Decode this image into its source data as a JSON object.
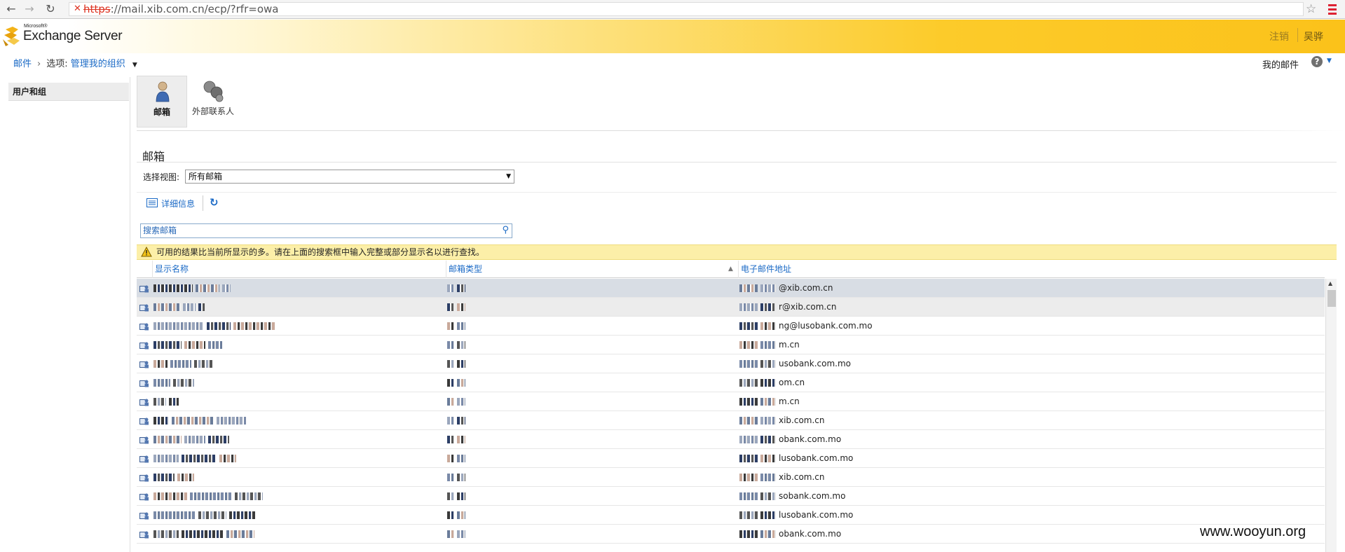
{
  "browser": {
    "url_scheme": "https",
    "url_rest": "://mail.xib.com.cn/ecp/?rfr=owa"
  },
  "header": {
    "logo_small": "Microsoft®",
    "logo_title": "Exchange Server",
    "signout": "注销",
    "user_name": "吴骅"
  },
  "breadcrumb": {
    "mail": "邮件",
    "options_prefix": "选项:",
    "options_link": "管理我的组织"
  },
  "top_right": {
    "my_mail": "我的邮件",
    "help": "?"
  },
  "sidebar": {
    "items": [
      {
        "label": "用户和组"
      }
    ]
  },
  "tabs": [
    {
      "label": "邮箱"
    },
    {
      "label": "外部联系人"
    }
  ],
  "section": {
    "title": "邮箱",
    "view_label": "选择视图:",
    "view_selected": "所有邮箱"
  },
  "toolbar": {
    "details": "详细信息"
  },
  "search": {
    "placeholder": "搜索邮箱"
  },
  "warning": {
    "text": "可用的结果比当前所显示的多。请在上面的搜索框中输入完整或部分显示名以进行查找。"
  },
  "grid": {
    "columns": [
      "显示名称",
      "邮箱类型",
      "电子邮件地址"
    ],
    "rows": [
      {
        "email_visible": "@xib.com.cn"
      },
      {
        "email_visible": "r@xib.com.cn"
      },
      {
        "email_visible": "ng@lusobank.com.mo"
      },
      {
        "email_visible": "m.cn"
      },
      {
        "email_visible": "usobank.com.mo"
      },
      {
        "email_visible": "om.cn"
      },
      {
        "email_visible": "m.cn"
      },
      {
        "email_visible": "xib.com.cn"
      },
      {
        "email_visible": "obank.com.mo"
      },
      {
        "email_visible": "lusobank.com.mo"
      },
      {
        "email_visible": "xib.com.cn"
      },
      {
        "email_visible": "sobank.com.mo"
      },
      {
        "email_visible": "lusobank.com.mo"
      },
      {
        "email_visible": "obank.com.mo"
      }
    ]
  },
  "watermark": "www.wooyun.org"
}
